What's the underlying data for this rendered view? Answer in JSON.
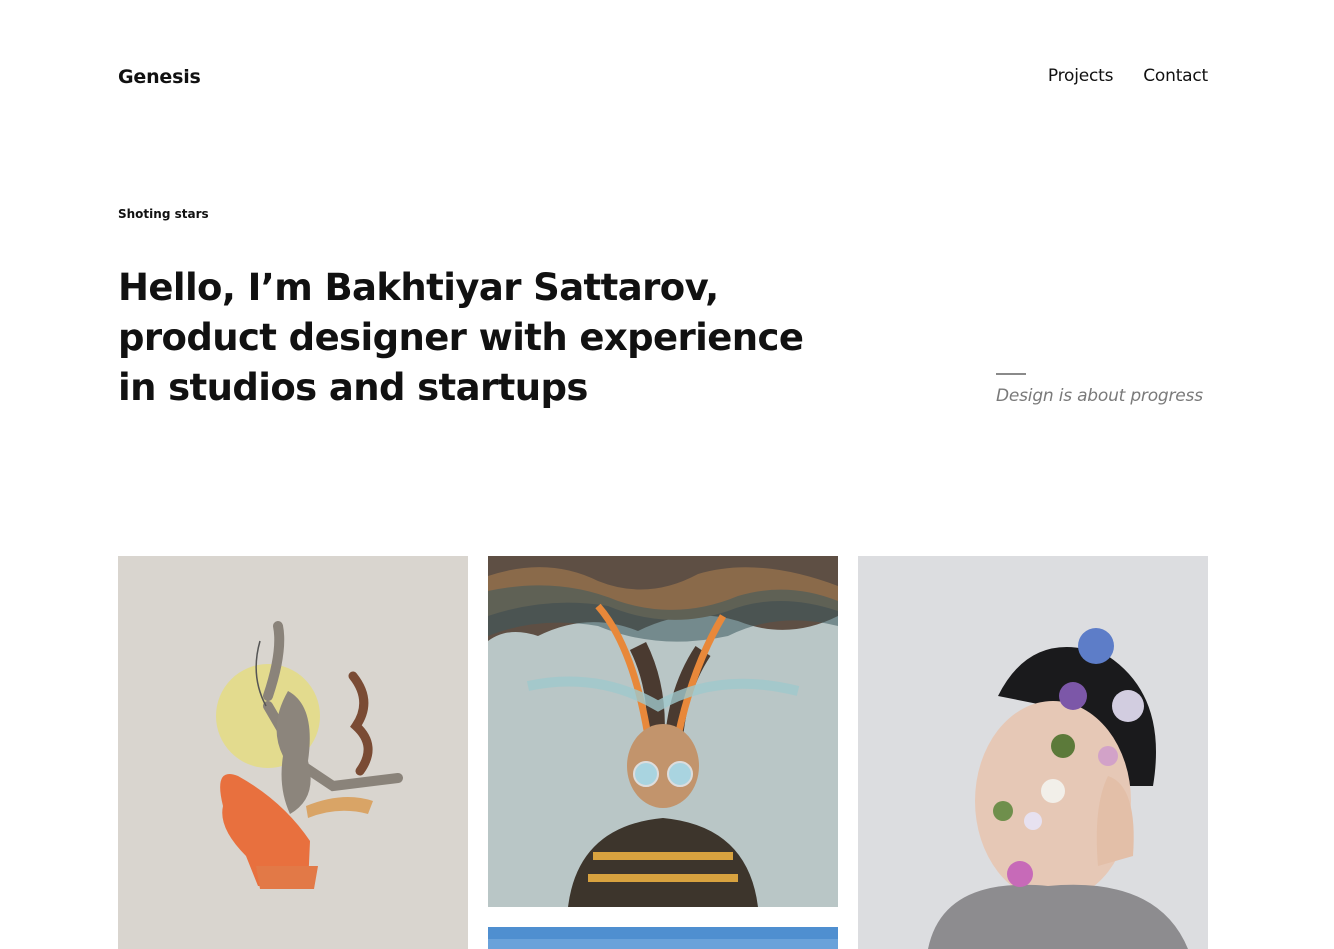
{
  "header": {
    "logo": "Genesis",
    "nav": [
      {
        "label": "Projects"
      },
      {
        "label": "Contact"
      }
    ]
  },
  "hero": {
    "eyebrow": "Shoting stars",
    "headline_lines": [
      "Hello, I’m Bakhtiyar Sattarov,",
      "product designer with experience",
      "in studios and startups"
    ],
    "tagline": "Design is about progress"
  },
  "projects": [
    {
      "image": "collage-dancer-illustration"
    },
    {
      "image": "surreal-portrait-with-sunglasses"
    },
    {
      "image": "portrait-with-flowers"
    },
    {
      "image": "blue-sky-photo"
    }
  ],
  "colors": {
    "text": "#111111",
    "muted": "#7a7a7a",
    "background": "#ffffff"
  }
}
